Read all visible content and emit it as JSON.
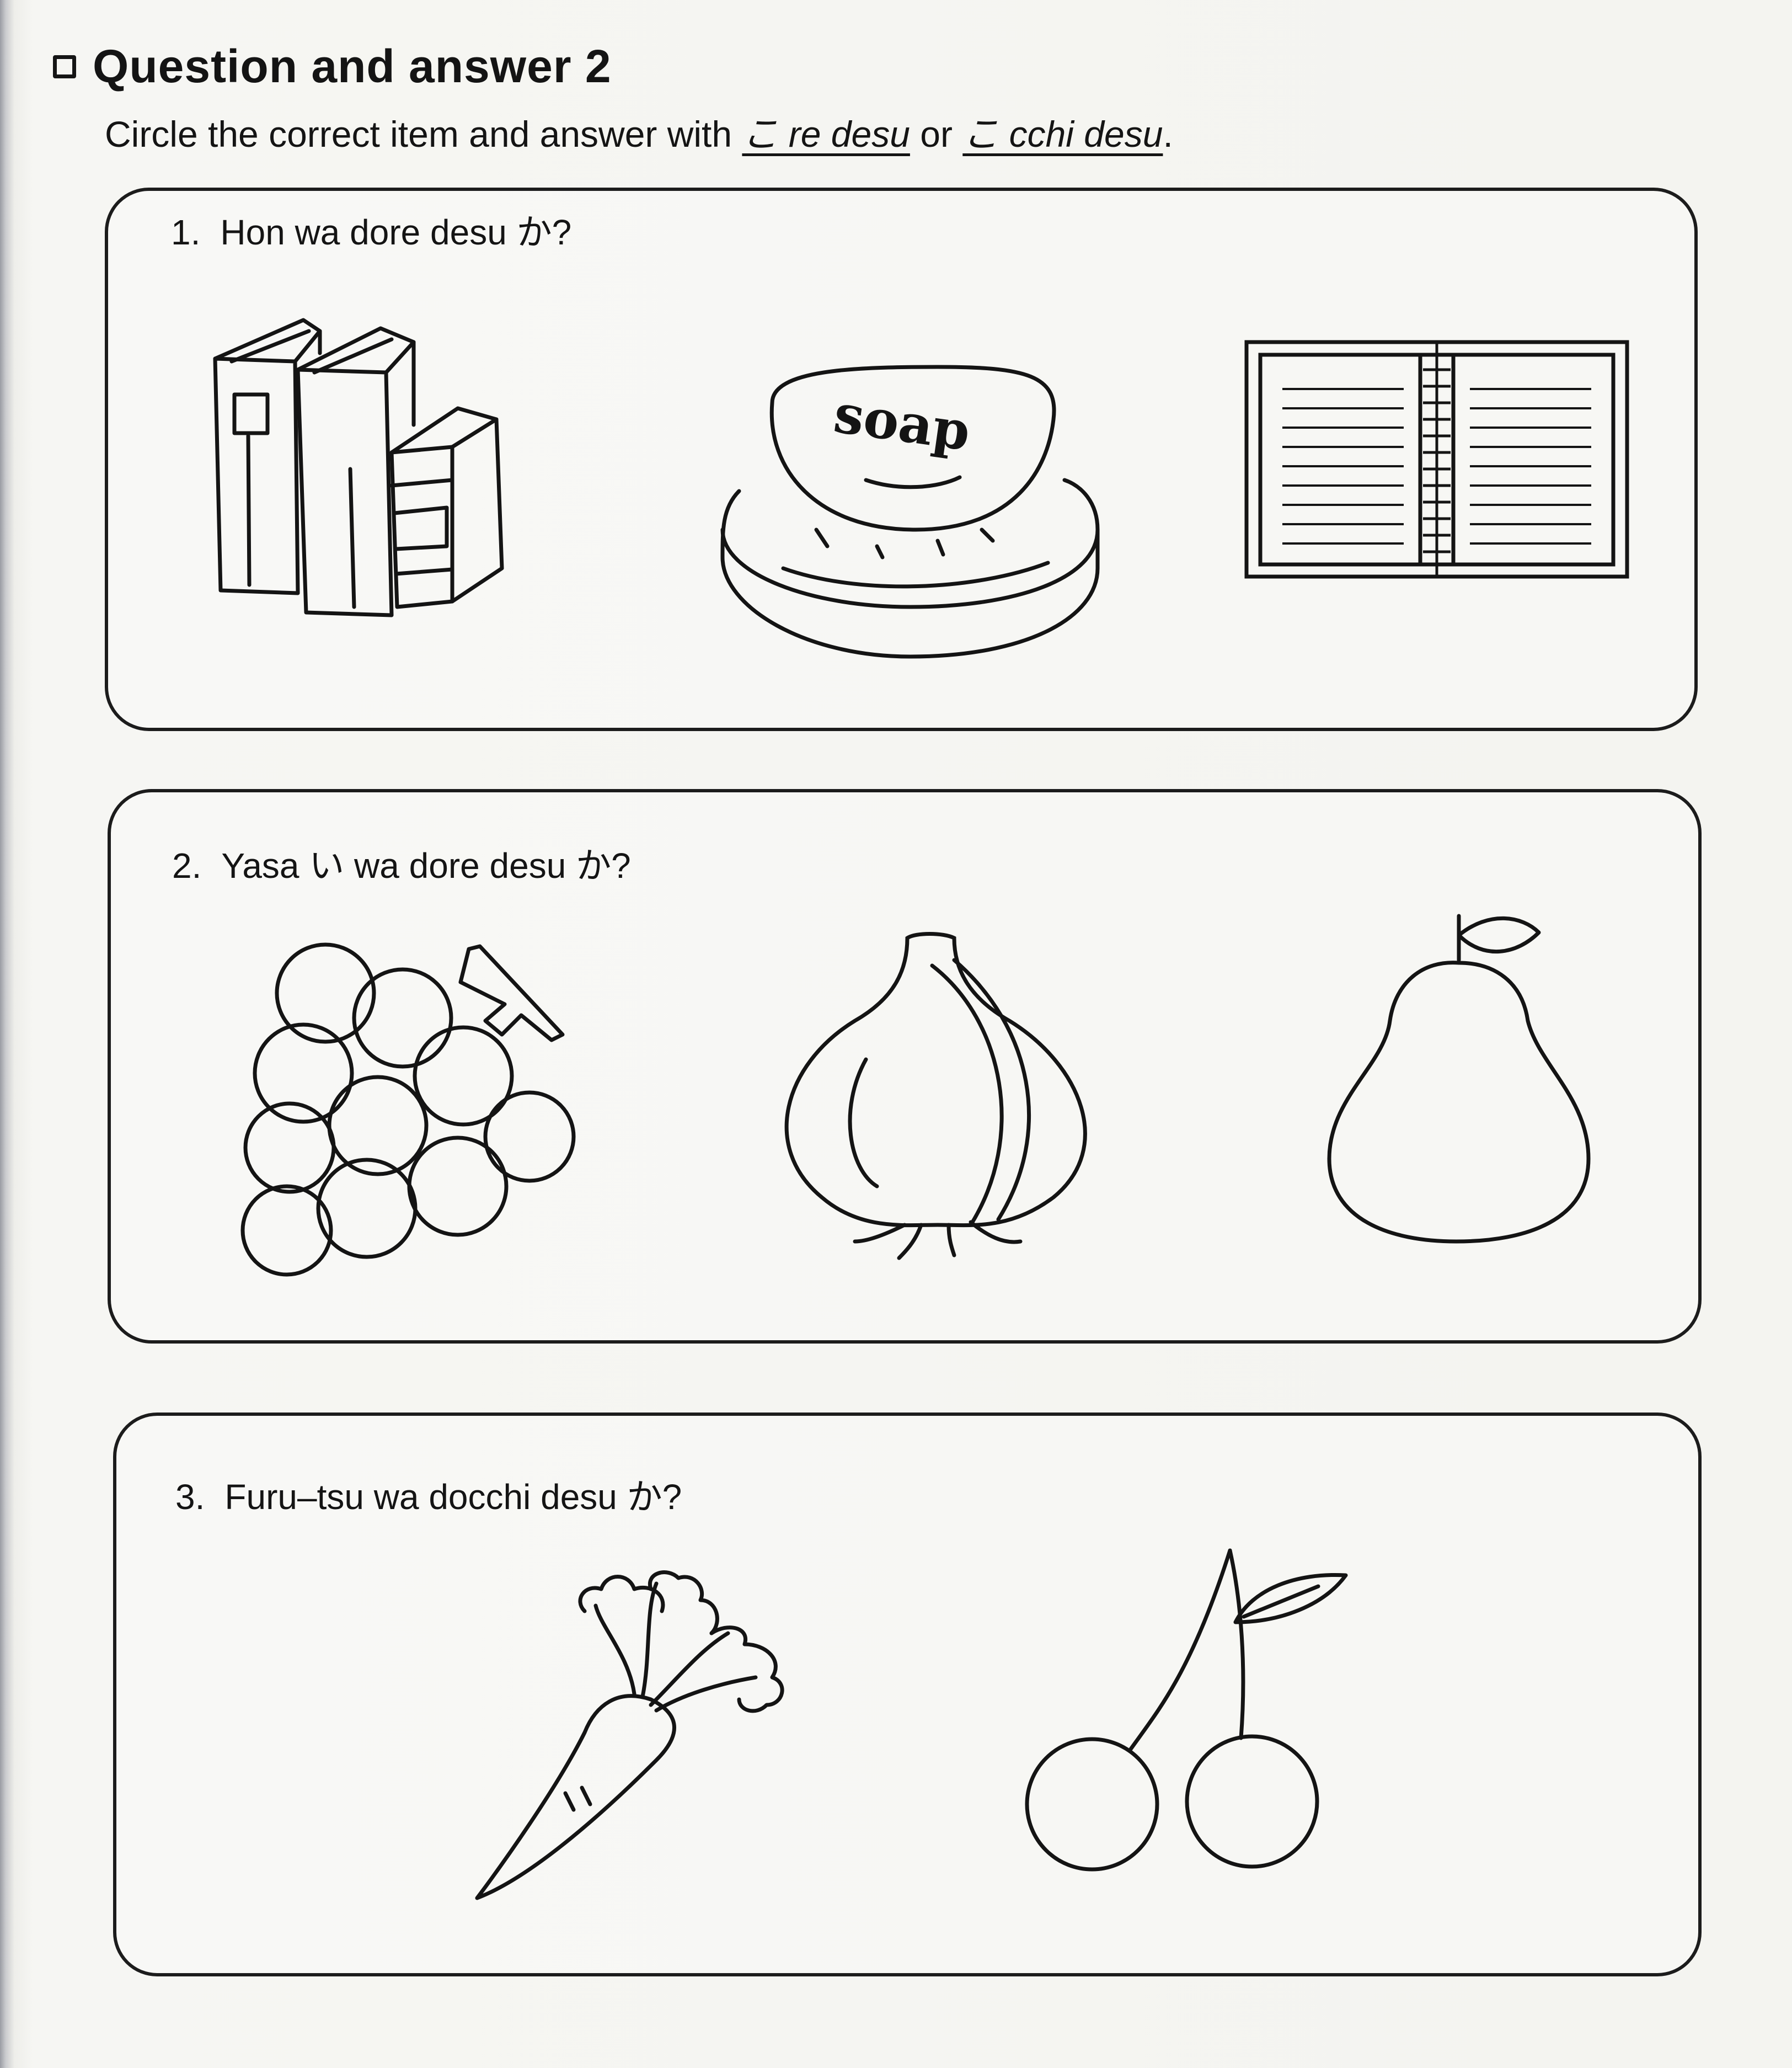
{
  "header": {
    "title": "Question and answer 2",
    "instruction_prefix": "Circle the correct item and answer with ",
    "option1": "こ re desu",
    "instruction_or": " or ",
    "option2": "こ cchi desu",
    "instruction_end": "."
  },
  "questions": [
    {
      "number": "1.",
      "text": "Hon wa dore desu か?",
      "items": [
        "books-icon",
        "soap-icon",
        "notebook-icon"
      ],
      "soap_label": "soap"
    },
    {
      "number": "2.",
      "text": "Yasa い wa dore desu か?",
      "items": [
        "grapes-icon",
        "onion-icon",
        "pear-icon"
      ]
    },
    {
      "number": "3.",
      "text": "Furu–tsu wa docchi desu か?",
      "items": [
        "carrot-icon",
        "cherries-icon"
      ]
    }
  ],
  "colors": {
    "ink": "#141414",
    "paper": "#f4f4f0"
  }
}
